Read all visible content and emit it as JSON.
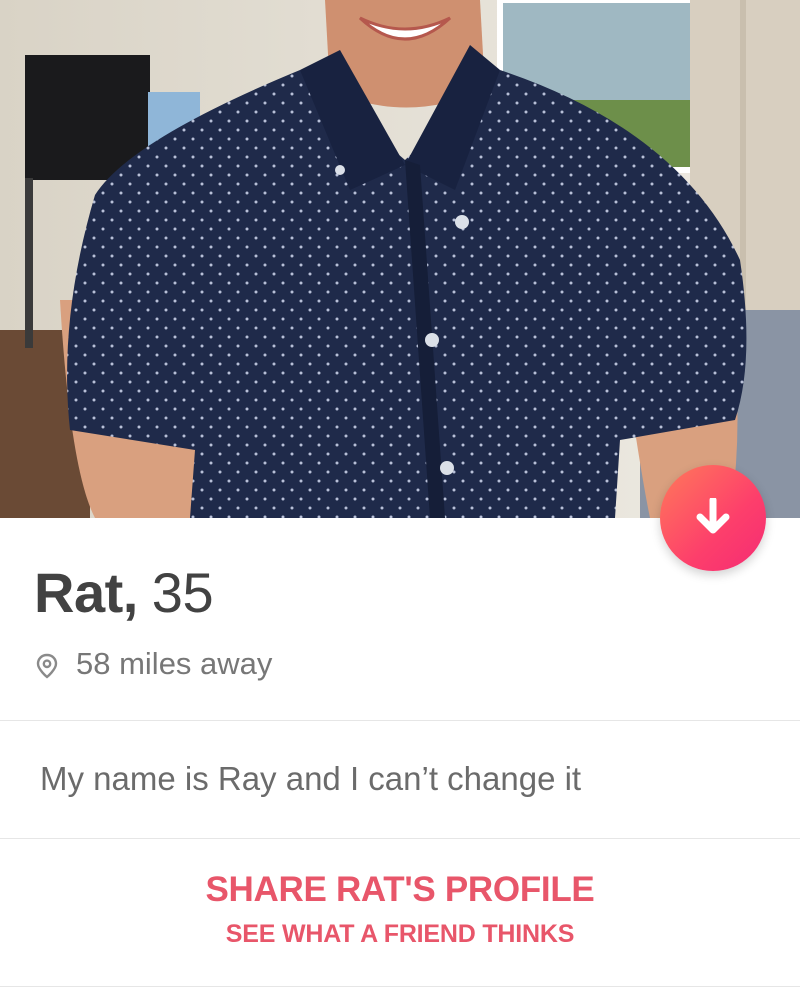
{
  "profile": {
    "name": "Rat,",
    "age": "35",
    "distance": "58 miles away",
    "bio": "My name is Ray and I can’t change it"
  },
  "share": {
    "title": "SHARE RAT'S PROFILE",
    "subtitle": "SEE WHAT A FRIEND THINKS"
  },
  "icons": {
    "collapse": "arrow-down-icon",
    "location": "location-pin-icon"
  },
  "colors": {
    "accent": "#fd3f6b",
    "accent_gradient_start": "#ff7a5a",
    "share_text": "#e8566a",
    "name_text": "#424242",
    "secondary_text": "#777777"
  }
}
